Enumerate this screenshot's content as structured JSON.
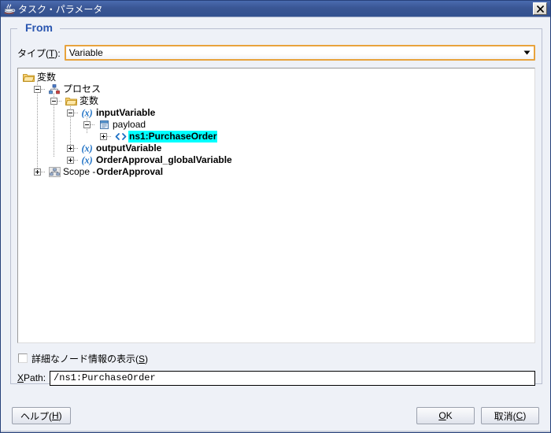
{
  "window": {
    "title": "タスク・パラメータ",
    "title_icon": "java-coffee-cup-icon",
    "close_label": "×",
    "titlebar_color": "#3a5694",
    "accent_color": "#2a56b0"
  },
  "group": {
    "title": "From"
  },
  "type_row": {
    "label_text": "タイプ(",
    "label_mnemonic": "T",
    "label_suffix": "):",
    "combo_value": "Variable",
    "combo_focus_color": "#e8a33d",
    "arrow_icon": "chevron-down-icon"
  },
  "tree": {
    "selection_color": "#00ffff",
    "nodes": [
      {
        "id": "root-henshu",
        "label": "変数",
        "icon": "folder-icon",
        "bold": false,
        "depth": 0,
        "toggle": "none",
        "selected": false
      },
      {
        "id": "process",
        "label": "プロセス",
        "icon": "process-icon",
        "bold": false,
        "depth": 1,
        "toggle": "minus",
        "selected": false
      },
      {
        "id": "variables-folder",
        "label": "変数",
        "icon": "folder-icon",
        "bold": false,
        "depth": 2,
        "toggle": "minus",
        "selected": false
      },
      {
        "id": "input-variable",
        "label": "inputVariable",
        "icon": "variable-x-icon",
        "bold": true,
        "depth": 3,
        "toggle": "minus",
        "selected": false
      },
      {
        "id": "payload",
        "label": "payload",
        "icon": "document-icon",
        "bold": false,
        "depth": 4,
        "toggle": "minus",
        "selected": false
      },
      {
        "id": "ns1-purchaseorder",
        "label": "ns1:PurchaseOrder",
        "icon": "xml-element-icon",
        "bold": true,
        "depth": 5,
        "toggle": "plus",
        "selected": true
      },
      {
        "id": "output-variable",
        "label": "outputVariable",
        "icon": "variable-x-icon",
        "bold": true,
        "depth": 3,
        "toggle": "plus",
        "selected": false
      },
      {
        "id": "order-approval-global-variable",
        "label": "OrderApproval_globalVariable",
        "icon": "variable-x-icon",
        "bold": true,
        "depth": 3,
        "toggle": "plus",
        "selected": false
      },
      {
        "id": "scope-order-approval",
        "label_plain": "Scope - ",
        "label_bold": "OrderApproval",
        "icon": "scope-icon",
        "bold": false,
        "depth": 2,
        "toggle": "plus",
        "selected": false
      }
    ]
  },
  "detail_checkbox": {
    "checked": false,
    "label_text": "詳細なノード情報の表示(",
    "label_mnemonic": "S",
    "label_suffix": ")"
  },
  "xpath": {
    "label_mnemonic": "X",
    "label_suffix": "Path:",
    "value": "/ns1:PurchaseOrder"
  },
  "buttons": {
    "help_text": "ヘルプ(",
    "help_mnemonic": "H",
    "help_suffix": ")",
    "ok_mnemonic": "O",
    "ok_suffix": "K",
    "cancel_text": "取消(",
    "cancel_mnemonic": "C",
    "cancel_suffix": ")"
  }
}
